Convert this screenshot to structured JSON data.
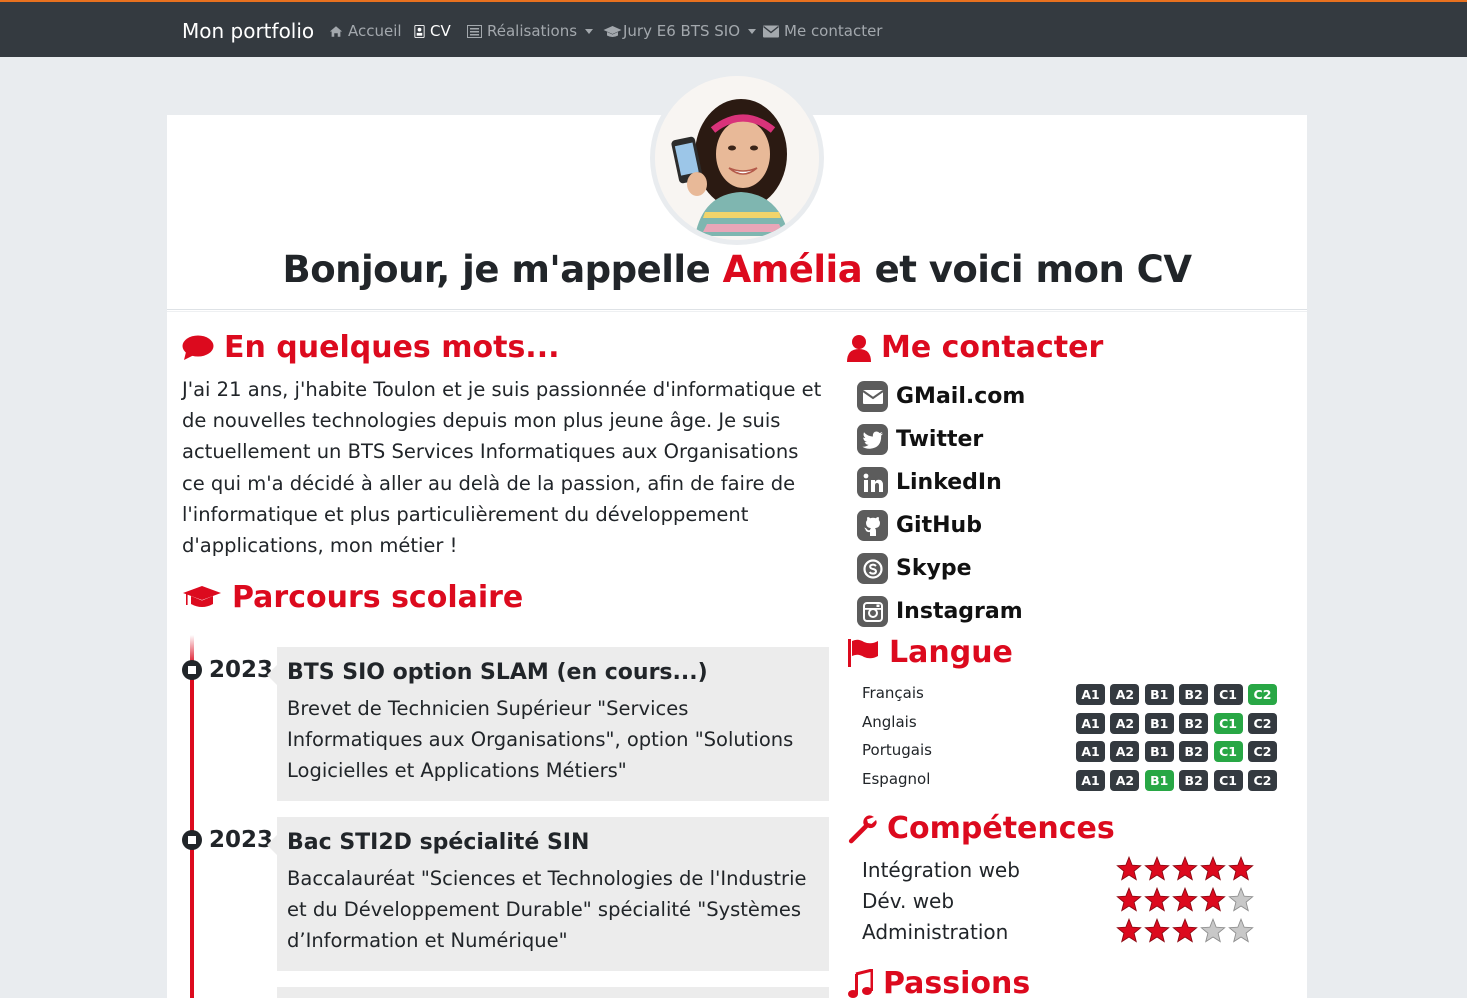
{
  "nav": {
    "brand": "Mon portfolio",
    "items": [
      {
        "label": "Accueil",
        "icon": "home-icon"
      },
      {
        "label": "CV",
        "icon": "id-card-icon",
        "active": true
      },
      {
        "label": "Réalisations",
        "icon": "list-icon",
        "dropdown": true
      },
      {
        "label": "Jury E6 BTS SIO",
        "icon": "graduation-cap-icon",
        "dropdown": true
      },
      {
        "label": "Me contacter",
        "icon": "envelope-icon"
      }
    ]
  },
  "hero": {
    "title_pre": "Bonjour, je m'appelle ",
    "name": "Amélia",
    "title_post": " et voici mon CV"
  },
  "about": {
    "title": "En quelques mots...",
    "text": "J'ai 21 ans, j'habite Toulon et je suis passionnée d'informatique et de nouvelles technologies depuis mon plus jeune âge. Je suis actuellement un BTS Services Informatiques aux Organisations ce qui m'a décidé à aller au delà de la passion, afin de faire de l'informatique et plus particulièrement du développement d'applications, mon métier !"
  },
  "education": {
    "title": "Parcours scolaire",
    "items": [
      {
        "year": "2023",
        "title": "BTS SIO option SLAM (en cours...)",
        "desc": "Brevet de Technicien Supérieur \"Services Informatiques aux Organisations\", option \"Solutions Logicielles et Applications Métiers\""
      },
      {
        "year": "2023",
        "title": "Bac STI2D spécialité SIN",
        "desc": "Baccalauréat \"Sciences et Technologies de l'Industrie et du Développement Durable\" spécialité \"Systèmes d’Information et Numérique\""
      }
    ]
  },
  "contact": {
    "title": "Me contacter",
    "items": [
      {
        "label": "GMail.com",
        "icon": "gmail-icon"
      },
      {
        "label": "Twitter",
        "icon": "twitter-icon"
      },
      {
        "label": "LinkedIn",
        "icon": "linkedin-icon"
      },
      {
        "label": "GitHub",
        "icon": "github-icon"
      },
      {
        "label": "Skype",
        "icon": "skype-icon"
      },
      {
        "label": "Instagram",
        "icon": "instagram-icon"
      }
    ]
  },
  "languages": {
    "title": "Langue",
    "levels": [
      "A1",
      "A2",
      "B1",
      "B2",
      "C1",
      "C2"
    ],
    "items": [
      {
        "name": "Français",
        "level": "C2"
      },
      {
        "name": "Anglais",
        "level": "C1"
      },
      {
        "name": "Portugais",
        "level": "C1"
      },
      {
        "name": "Espagnol",
        "level": "B1"
      }
    ]
  },
  "skills": {
    "title": "Compétences",
    "max": 5,
    "items": [
      {
        "name": "Intégration web",
        "rating": 5
      },
      {
        "name": "Dév. web",
        "rating": 4
      },
      {
        "name": "Administration",
        "rating": 3
      }
    ]
  },
  "passions": {
    "title": "Passions"
  },
  "colors": {
    "accent": "#dc0a1e",
    "navbar": "#343a40",
    "badge_active": "#28a745",
    "badge": "#343a40",
    "star_on": "#dc0a1e",
    "star_off": "#c8c8c8"
  }
}
